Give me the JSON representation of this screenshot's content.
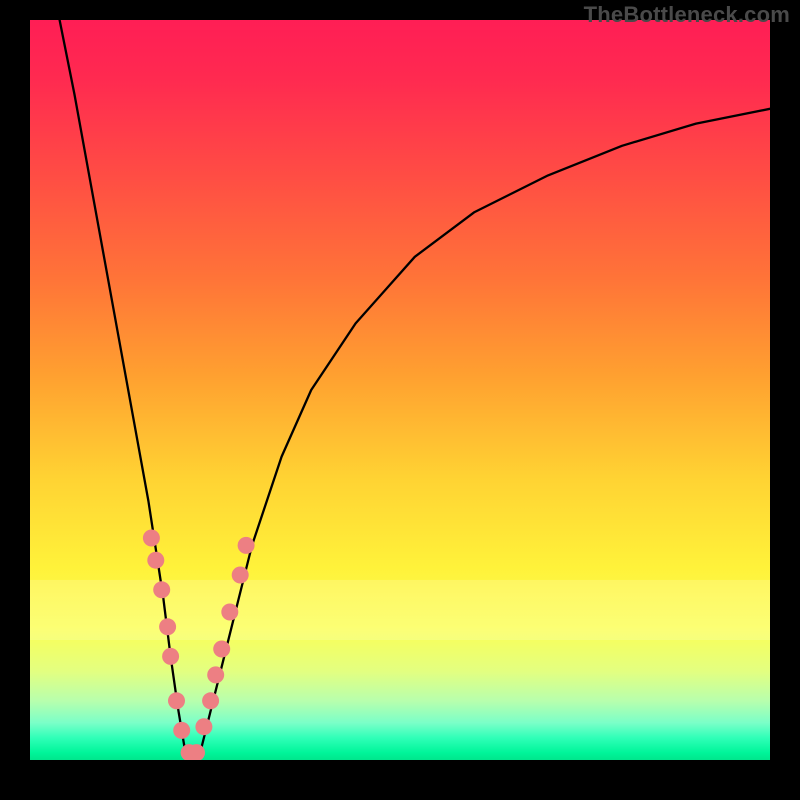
{
  "watermark": "TheBottleneck.com",
  "chart_data": {
    "type": "line",
    "title": "",
    "xlabel": "",
    "ylabel": "",
    "xlim": [
      0,
      100
    ],
    "ylim": [
      0,
      100
    ],
    "background_gradient": {
      "top": "#ff1e55",
      "middle": "#ffd333",
      "bottom": "#00e68c"
    },
    "highlight_band_y": [
      20,
      28
    ],
    "series": [
      {
        "name": "bottleneck-curve",
        "color": "#000000",
        "x": [
          4,
          6,
          8,
          10,
          12,
          14,
          16,
          18,
          19,
          20,
          21,
          22,
          23,
          24,
          26,
          28,
          30,
          34,
          38,
          44,
          52,
          60,
          70,
          80,
          90,
          100
        ],
        "values": [
          100,
          90,
          79,
          68,
          57,
          46,
          35,
          22,
          14,
          7,
          1,
          0,
          1,
          5,
          13,
          21,
          29,
          41,
          50,
          59,
          68,
          74,
          79,
          83,
          86,
          88
        ]
      }
    ],
    "markers": {
      "name": "highlight-dots",
      "color": "#ed7f83",
      "points": [
        {
          "x": 16.4,
          "y": 30
        },
        {
          "x": 17.0,
          "y": 27
        },
        {
          "x": 17.8,
          "y": 23
        },
        {
          "x": 18.6,
          "y": 18
        },
        {
          "x": 19.0,
          "y": 14
        },
        {
          "x": 19.8,
          "y": 8
        },
        {
          "x": 20.5,
          "y": 4
        },
        {
          "x": 21.5,
          "y": 1
        },
        {
          "x": 22.5,
          "y": 1
        },
        {
          "x": 23.5,
          "y": 4.5
        },
        {
          "x": 24.4,
          "y": 8
        },
        {
          "x": 25.1,
          "y": 11.5
        },
        {
          "x": 25.9,
          "y": 15
        },
        {
          "x": 27.0,
          "y": 20
        },
        {
          "x": 28.4,
          "y": 25
        },
        {
          "x": 29.2,
          "y": 29
        }
      ]
    }
  }
}
